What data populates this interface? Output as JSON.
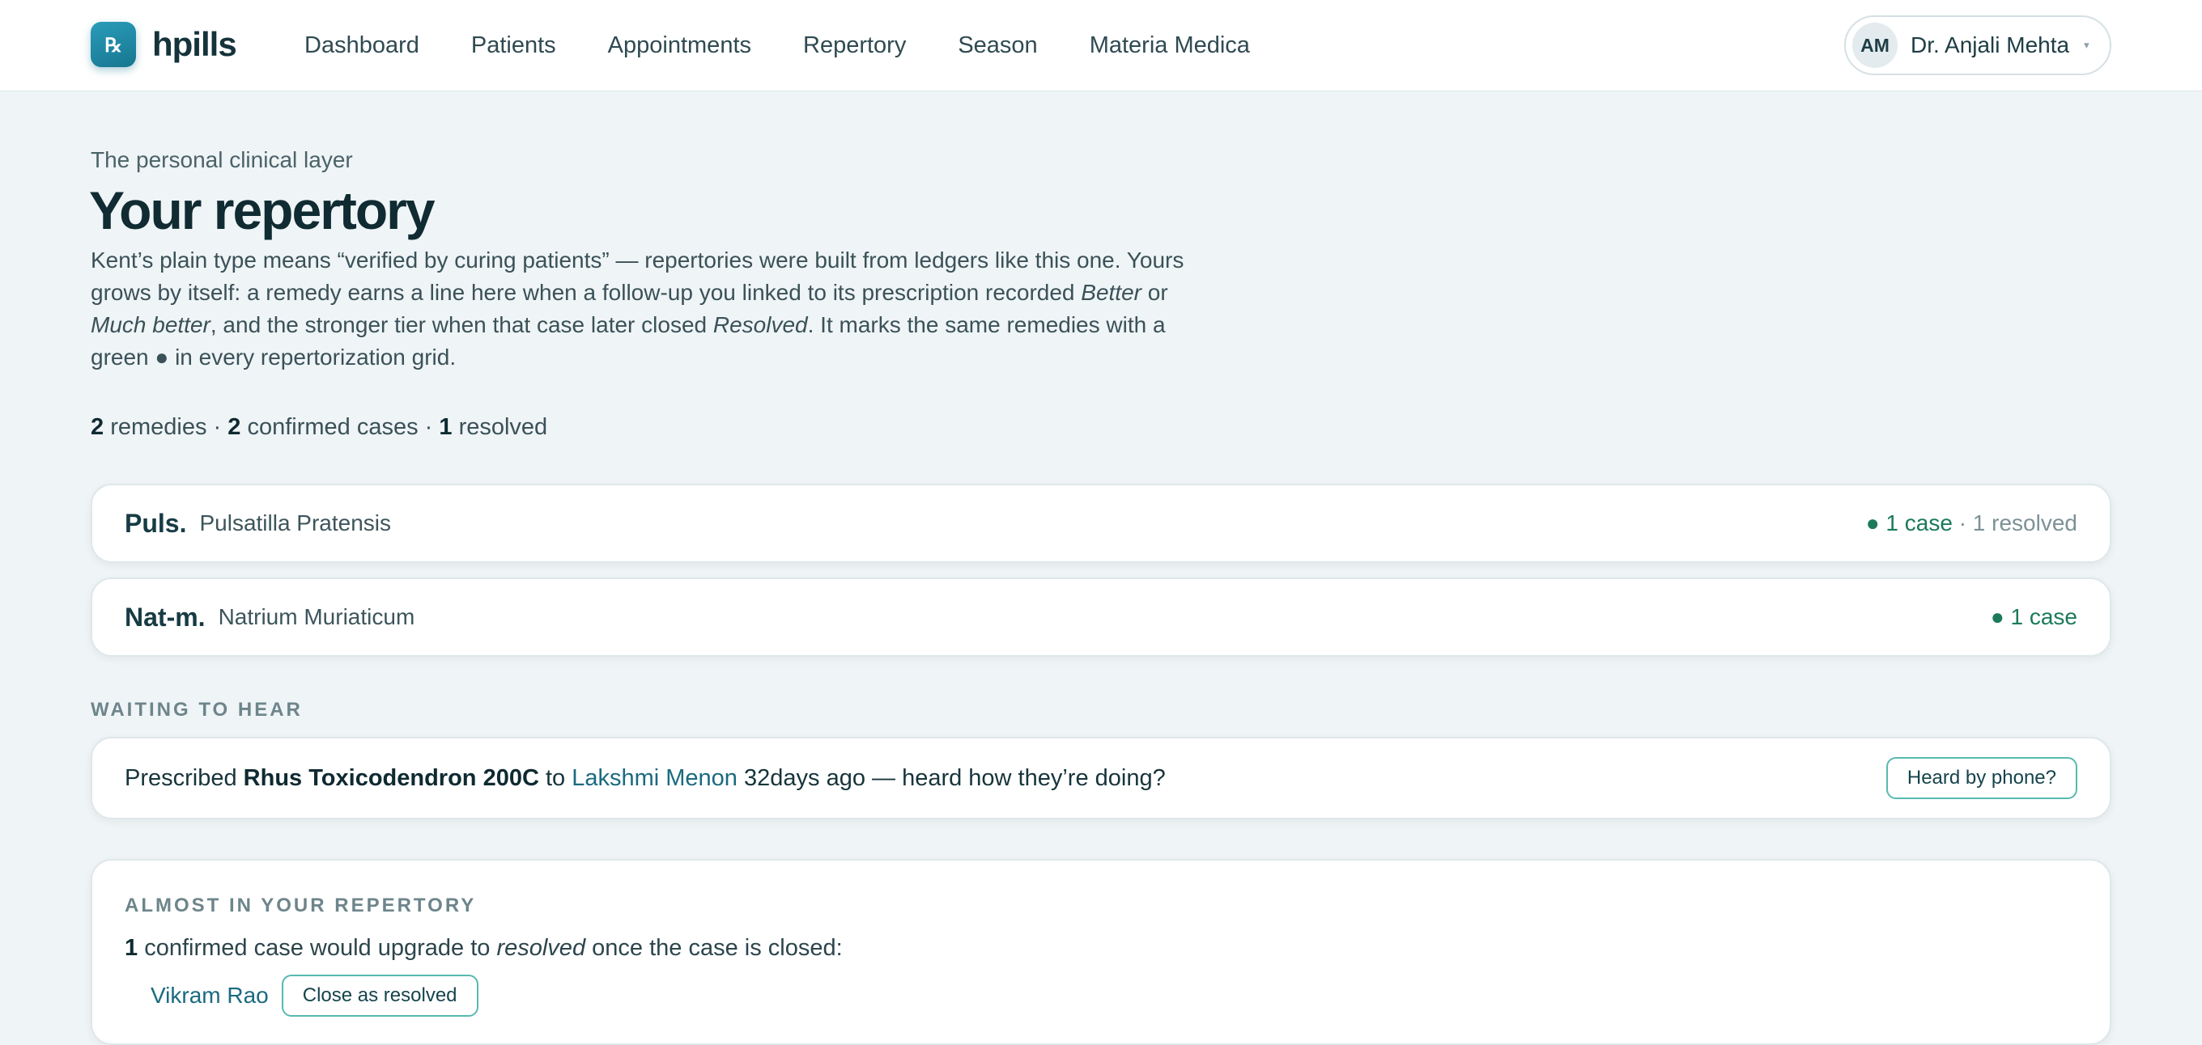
{
  "brand": {
    "logo_glyph": "℞",
    "name": "hpills",
    "accent": "#1f8aa8"
  },
  "nav": {
    "items": [
      {
        "label": "Dashboard"
      },
      {
        "label": "Patients"
      },
      {
        "label": "Appointments"
      },
      {
        "label": "Repertory"
      },
      {
        "label": "Season"
      },
      {
        "label": "Materia Medica"
      }
    ]
  },
  "user": {
    "initials": "AM",
    "name": "Dr. Anjali Mehta",
    "caret": "▾"
  },
  "intro": {
    "eyebrow": "The personal clinical layer",
    "title": "Your repertory",
    "p1": "Kent’s plain type means “verified by curing patients” — repertories were built from ledgers like this one. Yours grows by itself: a remedy earns a line here when a follow-up you linked to its prescription recorded ",
    "em1": "Better",
    "or": " or ",
    "em2": "Much better",
    "p2": ", and the stronger tier when that case later closed ",
    "em3": "Resolved",
    "p3": ". It marks the same remedies with a green ● in every repertorization grid."
  },
  "stats": {
    "remedies_count": "2",
    "remedies_label": " remedies · ",
    "confirmed_count": "2",
    "confirmed_label": " confirmed cases · ",
    "resolved_count": "1",
    "resolved_label": " resolved"
  },
  "remedies": [
    {
      "abbr": "Puls.",
      "name": "Pulsatilla Pratensis",
      "cases": "● 1 case",
      "resolved": " · 1 resolved"
    },
    {
      "abbr": "Nat-m.",
      "name": "Natrium Muriaticum",
      "cases": "● 1 case",
      "resolved": ""
    }
  ],
  "waiting": {
    "label": "WAITING TO HEAR",
    "prefix": "Prescribed ",
    "remedy": "Rhus Toxicodendron 200C",
    "to": " to ",
    "patient": "Lakshmi Menon",
    "suffix": " 32days ago — heard how they’re doing?",
    "button": "Heard by phone?"
  },
  "almost": {
    "label": "ALMOST IN YOUR REPERTORY",
    "count": "1",
    "text1": " confirmed case would upgrade to ",
    "em": "resolved",
    "text2": " once the case is closed:",
    "patient": "Vikram Rao",
    "button": "Close as resolved"
  },
  "colors": {
    "confirmed_green": "#1b7a5a",
    "link": "#1a6a80",
    "button_border": "#57b9b0"
  }
}
